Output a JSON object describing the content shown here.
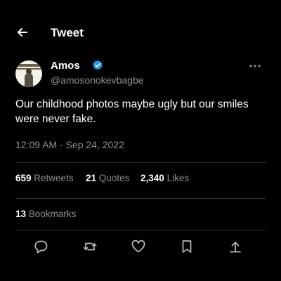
{
  "header": {
    "title": "Tweet"
  },
  "author": {
    "name": "Amos",
    "handle": "@amosonokevbagbe"
  },
  "tweet": {
    "text_line1": "Our childhood photos maybe ugly but our smiles",
    "text_line2": "were never fake.",
    "timestamp": "12:09 AM · Sep 24, 2022"
  },
  "stats": {
    "retweets_count": "659",
    "retweets_label": "Retweets",
    "quotes_count": "21",
    "quotes_label": "Quotes",
    "likes_count": "2,340",
    "likes_label": "Likes",
    "bookmarks_count": "13",
    "bookmarks_label": "Bookmarks"
  },
  "icons": {
    "back": "arrow-left-icon",
    "verified": "verified-badge-icon",
    "more": "more-options-icon",
    "reply": "reply-icon",
    "retweet": "retweet-icon",
    "like": "heart-icon",
    "bookmark": "bookmark-icon",
    "share": "share-icon"
  },
  "colors": {
    "background": "#000000",
    "text": "#ffffff",
    "muted": "#8b8f94",
    "verified": "#1d9bf0"
  }
}
